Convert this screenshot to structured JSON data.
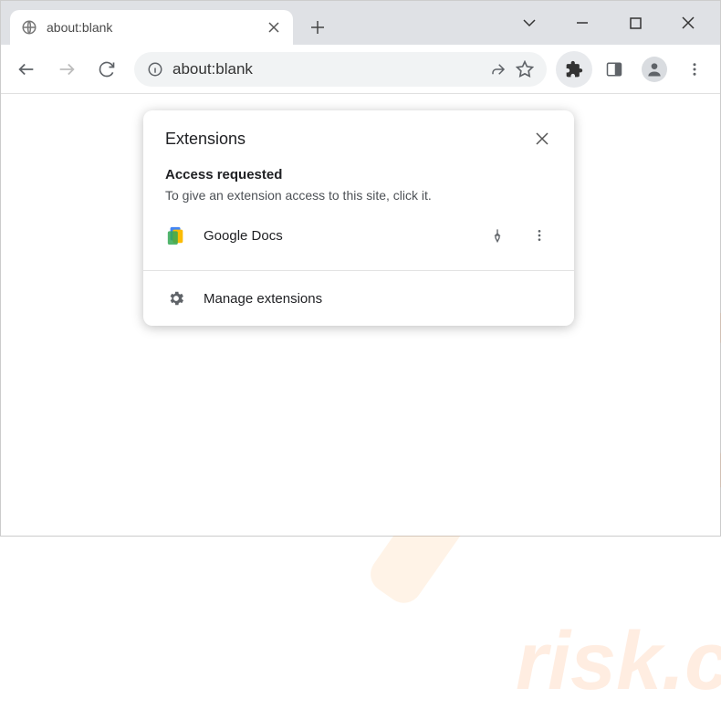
{
  "tab": {
    "title": "about:blank"
  },
  "address": {
    "url": "about:blank"
  },
  "popup": {
    "title": "Extensions",
    "access_heading": "Access requested",
    "access_desc": "To give an extension access to this site, click it.",
    "extension_name": "Google Docs",
    "manage_label": "Manage extensions"
  }
}
